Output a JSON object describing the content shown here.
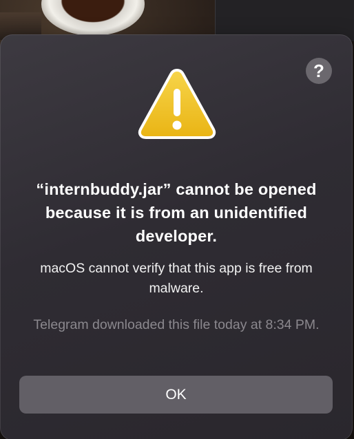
{
  "dialog": {
    "title": "“internbuddy.jar” cannot be opened because it is from an unidentified developer.",
    "message": "macOS cannot verify that this app is free from malware.",
    "note": "Telegram downloaded this file today at 8:34 PM.",
    "ok_label": "OK",
    "help_label": "?",
    "icon": "warning-icon",
    "colors": {
      "icon_yellow": "#f3c623",
      "button_bg": "#625f66",
      "dialog_bg": "#322f36"
    }
  }
}
